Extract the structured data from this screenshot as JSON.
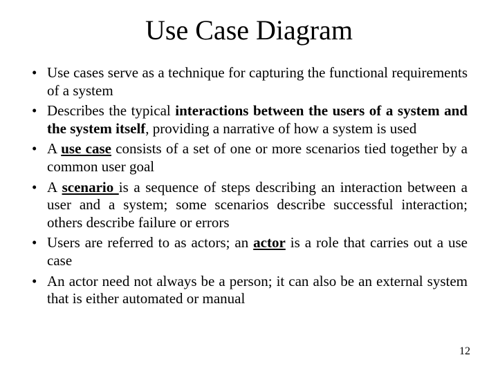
{
  "title": "Use Case Diagram",
  "bullets": {
    "b1_a": "Use cases serve as a technique for capturing the functional requirements of a system",
    "b2_a": "Describes the typical ",
    "b2_b": "interactions between the users of a system and the system itself",
    "b2_c": ", providing a narrative of how a system is used",
    "b3_a": "A ",
    "b3_b": "use case",
    "b3_c": " consists of a set of one or more scenarios tied together by a common user goal",
    "b4_a": "A ",
    "b4_b": "scenario ",
    "b4_c": "is a sequence of steps describing an interaction between a user and a system; some scenarios describe successful interaction; others describe failure or errors",
    "b5_a": "Users are referred to as actors; an ",
    "b5_b": "actor",
    "b5_c": " is a role that carries out a use case",
    "b6_a": "An actor need not always be a person; it can also be an external system that is either automated or manual"
  },
  "page_number": "12"
}
